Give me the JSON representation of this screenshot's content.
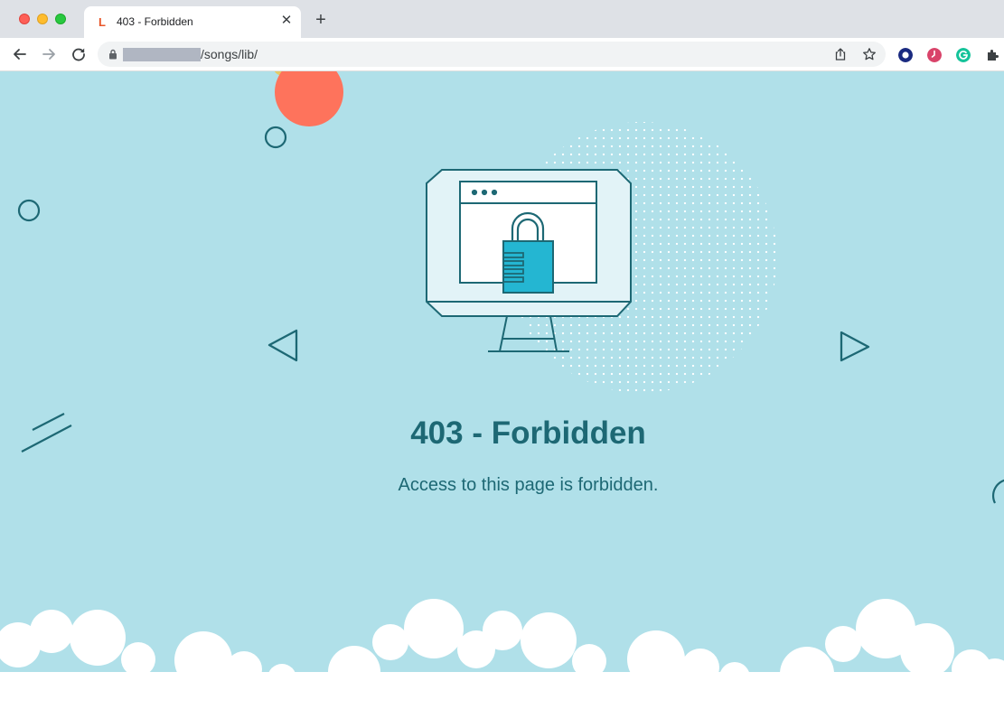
{
  "browser": {
    "tab": {
      "favicon": "L",
      "title": "403 - Forbidden",
      "close": "✕"
    },
    "new_tab": "+",
    "url_path": "/songs/lib/",
    "icons": {
      "back": "back-arrow-icon",
      "forward": "forward-arrow-icon",
      "reload": "reload-icon",
      "lock": "lock-icon",
      "share": "share-icon",
      "bookmark": "star-icon",
      "extensions": [
        "dark-circle-extension-icon",
        "clock-extension-icon",
        "grammarly-icon",
        "puzzle-extensions-icon"
      ]
    }
  },
  "page": {
    "title": "403 - Forbidden",
    "message": "Access to this page is forbidden.",
    "colors": {
      "background": "#b0e0e9",
      "text": "#1d6874",
      "accent_sun": "#fe735c",
      "lock": "#24b6d2"
    }
  }
}
